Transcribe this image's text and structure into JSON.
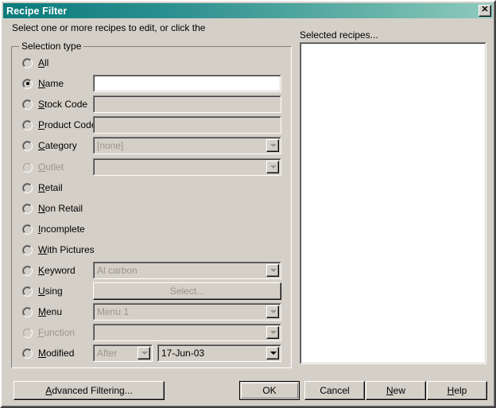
{
  "window": {
    "title": "Recipe Filter",
    "close_icon": "close-icon",
    "close_glyph": "✕"
  },
  "header": {
    "instruction": "Select one or more recipes to edit, or click the",
    "selected_label": "Selected recipes..."
  },
  "group": {
    "title": "Selection type"
  },
  "rows": [
    {
      "label_pre": "",
      "accel": "A",
      "label_post": "ll",
      "checked": false,
      "disabled": false,
      "control": "none"
    },
    {
      "label_pre": "",
      "accel": "N",
      "label_post": "ame",
      "checked": true,
      "disabled": false,
      "control": "textbox",
      "value": "",
      "control_enabled": true
    },
    {
      "label_pre": "",
      "accel": "S",
      "label_post": "tock Code",
      "checked": false,
      "disabled": false,
      "control": "textbox",
      "value": "",
      "control_enabled": false
    },
    {
      "label_pre": "",
      "accel": "P",
      "label_post": "roduct Code",
      "checked": false,
      "disabled": false,
      "control": "textbox",
      "value": "",
      "control_enabled": false
    },
    {
      "label_pre": "",
      "accel": "C",
      "label_post": "ategory",
      "checked": false,
      "disabled": false,
      "control": "combo",
      "value": "[none]",
      "control_enabled": false
    },
    {
      "label_pre": "",
      "accel": "O",
      "label_post": "utlet",
      "checked": false,
      "disabled": true,
      "control": "combo",
      "value": "",
      "control_enabled": false
    },
    {
      "label_pre": "",
      "accel": "R",
      "label_post": "etail",
      "checked": false,
      "disabled": false,
      "control": "none"
    },
    {
      "label_pre": "",
      "accel": "N",
      "label_post": "on Retail",
      "checked": false,
      "disabled": false,
      "control": "none"
    },
    {
      "label_pre": "",
      "accel": "I",
      "label_post": "ncomplete",
      "checked": false,
      "disabled": false,
      "control": "none"
    },
    {
      "label_pre": "",
      "accel": "W",
      "label_post": "ith Pictures",
      "checked": false,
      "disabled": false,
      "control": "none"
    },
    {
      "label_pre": "",
      "accel": "K",
      "label_post": "eyword",
      "checked": false,
      "disabled": false,
      "control": "combo",
      "value": "Al carbon",
      "control_enabled": false
    },
    {
      "label_pre": "",
      "accel": "U",
      "label_post": "sing",
      "checked": false,
      "disabled": false,
      "control": "button",
      "value": "Select...",
      "control_enabled": false
    },
    {
      "label_pre": "",
      "accel": "M",
      "label_post": "enu",
      "checked": false,
      "disabled": false,
      "control": "combo",
      "value": "Menu 1",
      "control_enabled": false
    },
    {
      "label_pre": "",
      "accel": "F",
      "label_post": "unction",
      "checked": false,
      "disabled": true,
      "control": "combo",
      "value": "",
      "control_enabled": false
    },
    {
      "label_pre": "",
      "accel": "M",
      "label_post": "odified",
      "checked": false,
      "disabled": false,
      "control": "modified",
      "operator": "After",
      "operator_enabled": false,
      "date": "17-Jun-03",
      "date_enabled": true
    }
  ],
  "footer": {
    "advanced_pre": "",
    "advanced_accel": "A",
    "advanced_post": "dvanced Filtering...",
    "ok": "OK",
    "cancel": "Cancel",
    "new_accel": "N",
    "new_post": "ew",
    "help_accel": "H",
    "help_post": "elp"
  },
  "colors": {
    "face": "#d4d0c8",
    "title_left": "#0a7b7b",
    "title_right": "#8ecabd",
    "disabled_text": "#9a958c",
    "text": "#000000",
    "field_bg_active": "#ffffff"
  }
}
